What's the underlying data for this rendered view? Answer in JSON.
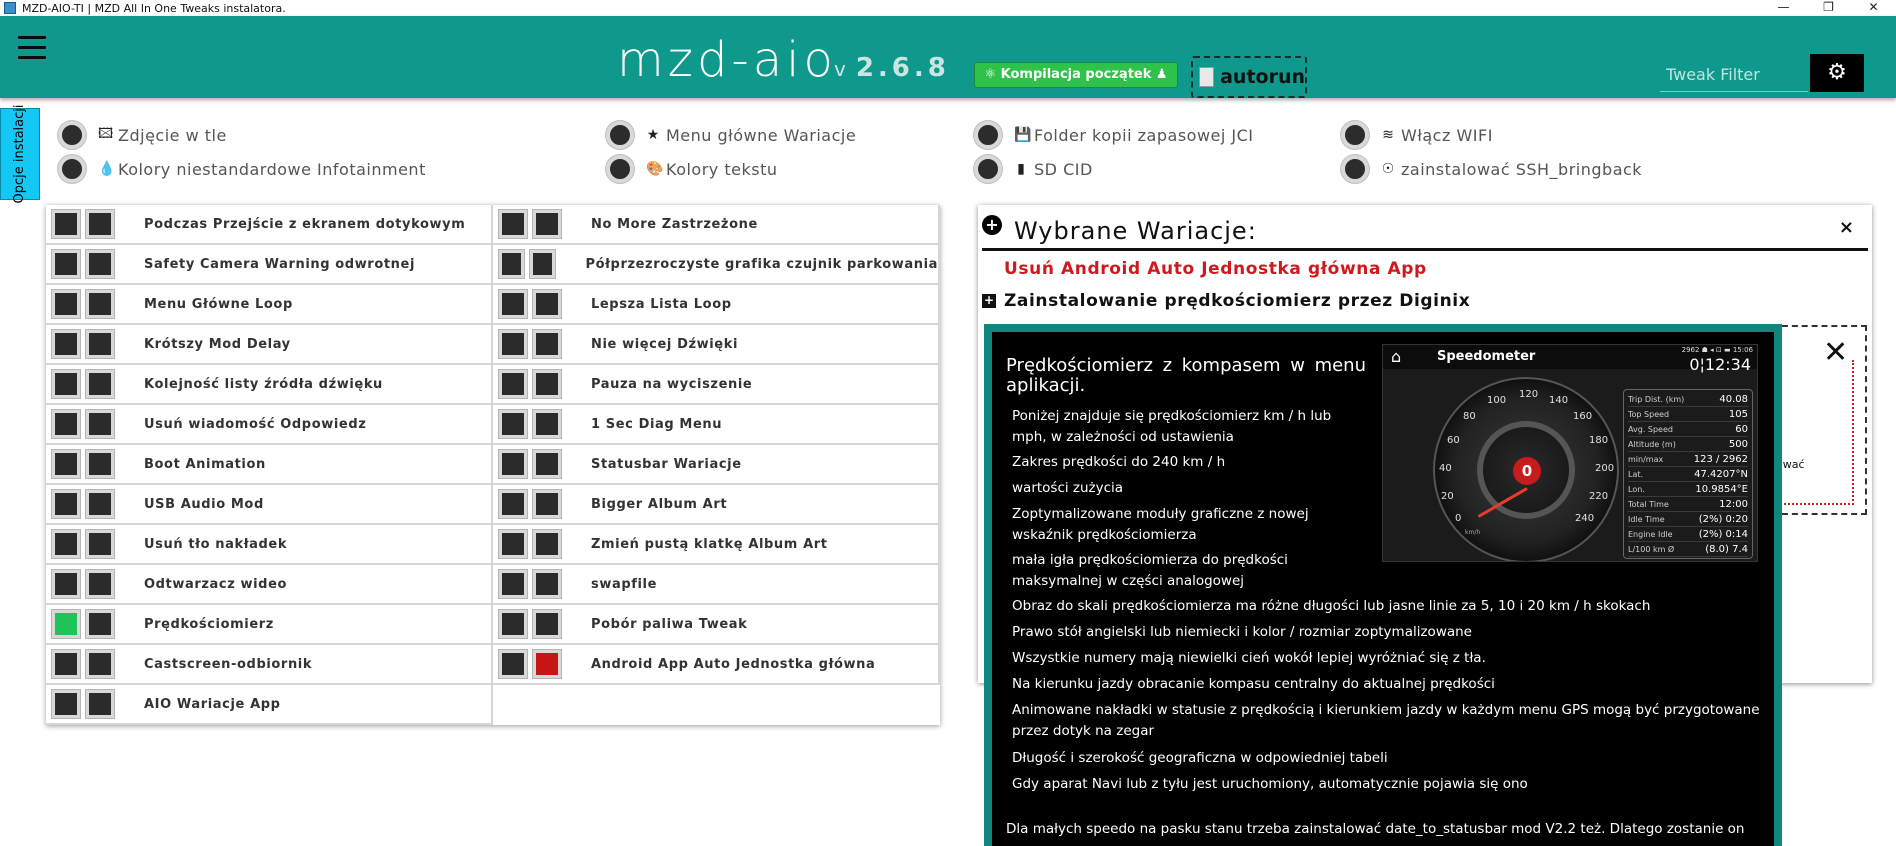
{
  "window": {
    "title": "MZD-AIO-TI | MZD All In One Tweaks instalatora.",
    "controls": [
      "—",
      "❐",
      "✕"
    ]
  },
  "header": {
    "brand": "mzd-aio",
    "version_prefix": "v",
    "version": "2.6.8",
    "compile_label": "⚛ Kompilacja początek ♟",
    "autorun_label": "autorun",
    "filter_placeholder": "Tweak Filter",
    "accent_color": "#0f998c"
  },
  "side_tab": {
    "label": "Opcje instalacji"
  },
  "install_options": [
    {
      "icon": "image-icon",
      "glyph": "🖾",
      "label": "Zdjęcie w tle"
    },
    {
      "icon": "drop-icon",
      "glyph": "💧",
      "label": "Kolory niestandardowe Infotainment"
    },
    {
      "icon": "star-icon",
      "glyph": "★",
      "label": "Menu główne Wariacje"
    },
    {
      "icon": "palette-icon",
      "glyph": "🎨",
      "label": "Kolory tekstu"
    },
    {
      "icon": "save-icon",
      "glyph": "💾",
      "label": "Folder kopii zapasowej JCI"
    },
    {
      "icon": "sd-card-icon",
      "glyph": "▮",
      "label": "SD CID"
    },
    {
      "icon": "wifi-icon",
      "glyph": "≋",
      "label": "Włącz WIFI"
    },
    {
      "icon": "fingerprint-icon",
      "glyph": "☉",
      "label": "zainstalować SSH_bringback"
    }
  ],
  "tweaks": {
    "left": [
      {
        "label": "Podczas Przejście z ekranem dotykowym",
        "state": "none"
      },
      {
        "label": "Safety Camera Warning odwrotnej",
        "state": "none"
      },
      {
        "label": "Menu Główne Loop",
        "state": "none"
      },
      {
        "label": "Krótszy Mod Delay",
        "state": "none"
      },
      {
        "label": "Kolejność listy źródła dźwięku",
        "state": "none"
      },
      {
        "label": "Usuń wiadomość Odpowiedz",
        "state": "none"
      },
      {
        "label": "Boot Animation",
        "state": "none"
      },
      {
        "label": "USB Audio Mod",
        "state": "none"
      },
      {
        "label": "Usuń tło nakładek",
        "state": "none"
      },
      {
        "label": "Odtwarzacz wideo",
        "state": "none"
      },
      {
        "label": "Prędkościomierz",
        "state": "install"
      },
      {
        "label": "Castscreen-odbiornik",
        "state": "none"
      },
      {
        "label": "AIO Wariacje App",
        "state": "none"
      }
    ],
    "right": [
      {
        "label": "No More Zastrzeżone",
        "state": "none"
      },
      {
        "label": "Półprzezroczyste grafika czujnik parkowania",
        "state": "none"
      },
      {
        "label": "Lepsza Lista Loop",
        "state": "none"
      },
      {
        "label": "Nie więcej Dźwięki",
        "state": "none"
      },
      {
        "label": "Pauza na wyciszenie",
        "state": "none"
      },
      {
        "label": "1 Sec Diag Menu",
        "state": "none"
      },
      {
        "label": "Statusbar Wariacje",
        "state": "none"
      },
      {
        "label": "Bigger Album Art",
        "state": "none"
      },
      {
        "label": "Zmień pustą klatkę Album Art",
        "state": "none"
      },
      {
        "label": "swapfile",
        "state": "none"
      },
      {
        "label": "Pobór paliwa Tweak",
        "state": "none"
      },
      {
        "label": "Android App Auto Jednostka główna",
        "state": "uninstall"
      }
    ]
  },
  "selected": {
    "title": "Wybrane Wariacje:",
    "close": "×",
    "uninstall_item": "Usuń Android Auto Jednostka główna App",
    "install_item": "Zainstalowanie prędkościomierz przez Diginix",
    "background_close": "✕",
    "background_text": "ować"
  },
  "info": {
    "title": "Prędkościomierz z kompasem w menu aplikacji.",
    "items": [
      "Poniżej znajduje się prędkościomierz km / h lub mph, w zależności od ustawienia",
      "Zakres prędkości do 240 km / h",
      "wartości zużycia",
      "Zoptymalizowane moduły graficzne z nowej wskaźnik prędkościomierza",
      "mała igła prędkościomierza do prędkości maksymalnej w części analogowej",
      "Obraz do skali prędkościomierza ma różne długości lub jasne linie za 5, 10 i 20 km / h skokach",
      "Prawo stół angielski lub niemiecki i kolor / rozmiar zoptymalizowane",
      "Wszystkie numery mają niewielki cień wokół lepiej wyróżniać się z tła.",
      "Na kierunku jazdy obracanie kompasu centralny do aktualnej prędkości",
      "Animowane nakładki w statusie z prędkością i kierunkiem jazdy w każdym menu GPS mogą być przygotowane przez dotyk na zegar",
      "Długość i szerokość geograficzna w odpowiedniej tabeli",
      "Gdy aparat Navi lub z tyłu jest uruchomiony, automatycznie pojawia się ono"
    ],
    "bottom": "Dla małych speedo na pasku stanu trzeba zainstalować date_to_statusbar mod V2.2 też. Dlatego zostanie on"
  },
  "speedometer_image": {
    "title": "Speedometer",
    "status": "2962 ☗ ◂ ⊡ ▬ 15:06",
    "clock": "0¦12:34",
    "center_value": "0",
    "unit": "km/h",
    "ticks": [
      "0",
      "20",
      "40",
      "60",
      "80",
      "100",
      "120",
      "140",
      "160",
      "180",
      "200",
      "220",
      "240"
    ],
    "stats": [
      {
        "key": "Trip Dist. (km)",
        "value": "40.08"
      },
      {
        "key": "Top Speed",
        "value": "105"
      },
      {
        "key": "Avg. Speed",
        "value": "60"
      },
      {
        "key": "Altitude (m)",
        "value": "500"
      },
      {
        "key": "min/max",
        "value": "123 / 2962"
      },
      {
        "key": "Lat.",
        "value": "47.4207°N"
      },
      {
        "key": "Lon.",
        "value": "10.9854°E"
      },
      {
        "key": "Total Time",
        "value": "12:00"
      },
      {
        "key": "Idle Time",
        "value": "(2%) 0:20"
      },
      {
        "key": "Engine Idle",
        "value": "(2%) 0:14"
      },
      {
        "key": "L/100 km Ø",
        "value": "(8.0) 7.4"
      }
    ]
  }
}
